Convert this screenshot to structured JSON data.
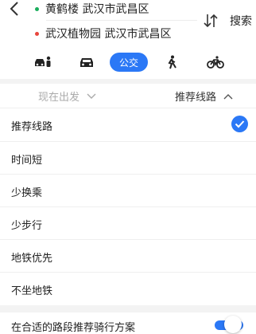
{
  "route": {
    "start": "黄鹤楼 武汉市武昌区",
    "end": "武汉植物园 武汉市武昌区",
    "start_dot_color": "#1aad5c",
    "end_dot_color": "#e8453c",
    "search_label": "搜索"
  },
  "modes": [
    {
      "name": "taxi",
      "icon": "car-person-icon"
    },
    {
      "name": "drive",
      "icon": "car-icon"
    },
    {
      "name": "bus",
      "label": "公交",
      "active": true
    },
    {
      "name": "walk",
      "icon": "walk-icon"
    },
    {
      "name": "bike",
      "icon": "bicycle-icon"
    }
  ],
  "sort": {
    "depart_label": "现在出发",
    "prefer_label": "推荐线路"
  },
  "options": [
    {
      "label": "推荐线路",
      "selected": true
    },
    {
      "label": "时间短",
      "selected": false
    },
    {
      "label": "少换乘",
      "selected": false
    },
    {
      "label": "少步行",
      "selected": false
    },
    {
      "label": "地铁优先",
      "selected": false
    },
    {
      "label": "不坐地铁",
      "selected": false
    }
  ],
  "bike_option": {
    "label": "在合适的路段推荐骑行方案",
    "enabled": true
  },
  "colors": {
    "accent": "#2b78f6"
  }
}
